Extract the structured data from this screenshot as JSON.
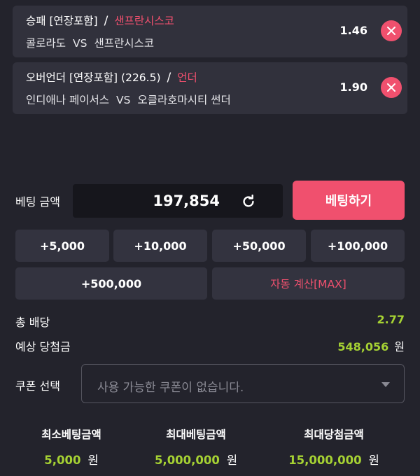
{
  "picks": [
    {
      "market": "승패 [연장포함]",
      "separator": "/",
      "selection": "샌프란시스코",
      "home": "콜로라도",
      "vs": "VS",
      "away": "샌프란시스코",
      "odds": "1.46"
    },
    {
      "market": "오버언더 [연장포함] (226.5)",
      "separator": "/",
      "selection": "언더",
      "home": "인디애나 페이서스",
      "vs": "VS",
      "away": "오클라호마시티 썬더",
      "odds": "1.90"
    }
  ],
  "bet": {
    "label": "베팅 금액",
    "amount": "197,854",
    "submit_label": "베팅하기"
  },
  "quick_amounts": [
    "+5,000",
    "+10,000",
    "+50,000",
    "+100,000",
    "+500,000"
  ],
  "auto_calc_label": "자동 계산[MAX]",
  "summary": {
    "total_odds_label": "총 배당",
    "total_odds": "2.77",
    "expected_label": "예상 당첨금",
    "expected_amount": "548,056",
    "currency": "원"
  },
  "coupon": {
    "label": "쿠폰 선택",
    "placeholder": "사용 가능한 쿠폰이 없습니다."
  },
  "limits": [
    {
      "label": "최소베팅금액",
      "amount": "5,000",
      "currency": "원"
    },
    {
      "label": "최대베팅금액",
      "amount": "5,000,000",
      "currency": "원"
    },
    {
      "label": "최대당첨금액",
      "amount": "15,000,000",
      "currency": "원"
    }
  ],
  "colors": {
    "accent": "#f0506e",
    "highlight_value": "#a6d233",
    "background": "#23232c",
    "card": "#31313c"
  },
  "icons": {
    "remove": "close-icon",
    "refresh": "refresh-icon",
    "dropdown": "chevron-down-icon"
  }
}
